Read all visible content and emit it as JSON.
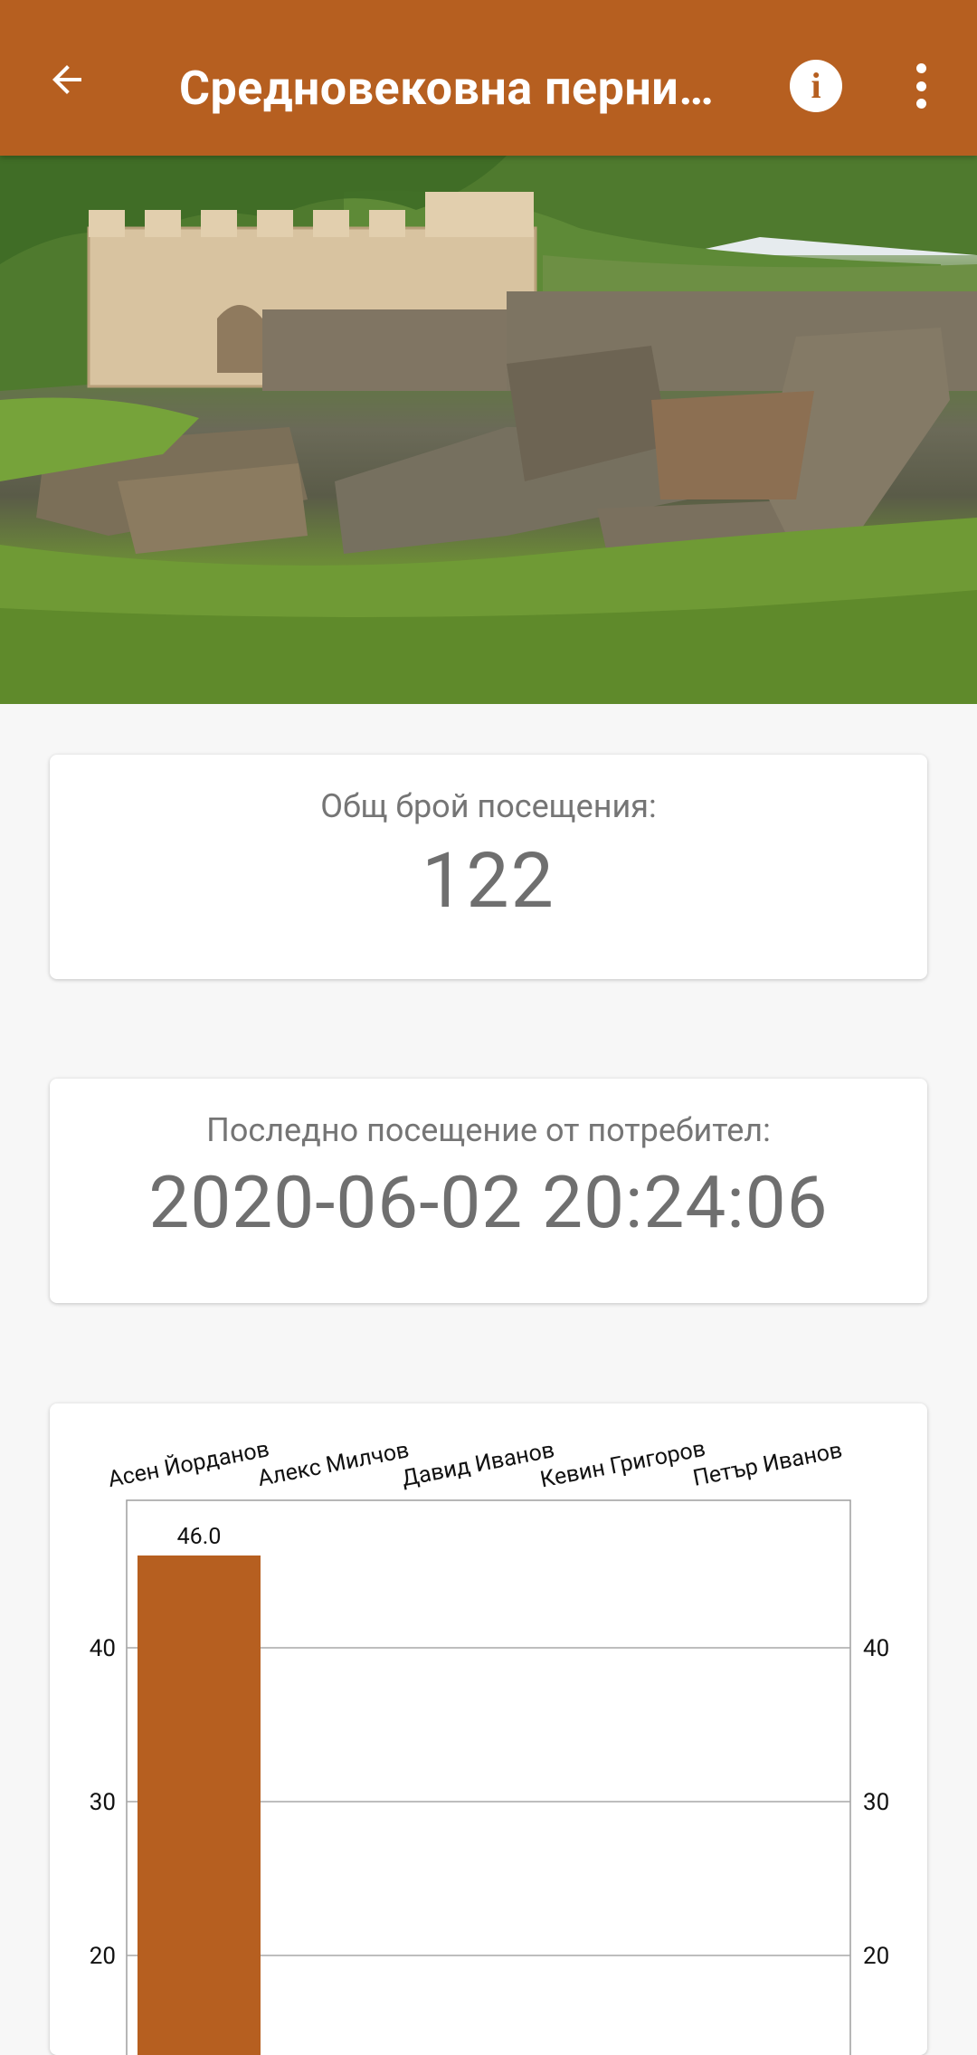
{
  "app_bar": {
    "title": "Средновековна перни…",
    "back_icon": "arrow-back-icon",
    "info_icon": "info-icon",
    "more_icon": "more-vert-icon",
    "color": "#b65f20"
  },
  "hero_image": {
    "description_icon": "fortress-photo"
  },
  "total_visits": {
    "label": "Общ брой посещения:",
    "value": "122"
  },
  "last_visit": {
    "label": "Последно посещение от потребител:",
    "value": "2020-06-02 20:24:06"
  },
  "chart_data": {
    "type": "bar",
    "categories": [
      "Асен Йорданов",
      "Алекс Милчов",
      "Давид Иванов",
      "Кевин Григоров",
      "Петър Иванов"
    ],
    "values": [
      46.0,
      null,
      null,
      null,
      null
    ],
    "value_labels": [
      "46.0"
    ],
    "yticks": [
      20,
      30,
      40
    ],
    "y_visible_range": [
      17,
      50
    ],
    "bar_color": "#b65f20",
    "grid": true,
    "ticks_both_sides": true
  }
}
